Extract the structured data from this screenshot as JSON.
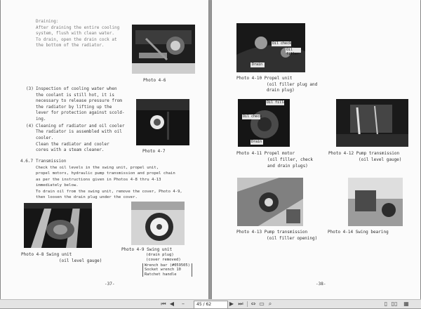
{
  "left_page": {
    "draining_title": "Draining:",
    "draining_lines": [
      "After draining the entire cooling",
      "system, flush with clean water.",
      "To drain, open the drain cock at",
      "the bottom of the radiator."
    ],
    "photo_4_6_caption": "Photo 4-6",
    "item3_num": "(3)",
    "item3_lines": [
      "Inspection of cooling water when",
      "the coolant is still hot, it is",
      "necessary to release pressure from",
      "the radiator by lifting up the",
      "lever for protection against scold-",
      "ing."
    ],
    "item4_num": "(4)",
    "item4_lines": [
      "Cleaning of radiator and oil cooler",
      "The radiator is assembled with oil",
      "cooler.",
      "Clean the radiator and cooler",
      "cores with a steam cleaner."
    ],
    "photo_4_7_caption": "Photo 4-7",
    "section_num": "4.6.7",
    "section_title": "Transmission",
    "section_lines": [
      "Check the oil levels in the swing unit, propel unit,",
      "propel motors, hydraulic pump transmission and propel chain",
      "as per the instructions given in Photos 4-8 thru 4-13",
      "immediately below.",
      "To drain oil from the swing unit, remove the cover, Photo 4-9,",
      "then loosen the drain plug under the cover."
    ],
    "photo_4_8_caption": "Photo 4-8  Swing unit",
    "photo_4_8_sub": "(oil level gauge)",
    "photo_4_9_caption": "Photo 4-9  Swing unit",
    "photo_4_9_sub1": "(drain plug)",
    "photo_4_9_sub2": "(cover removed)",
    "tools": [
      "Wrench bar (#059505)",
      "Socket wrench 10",
      "Ratchet handle"
    ],
    "page_number": "-37-"
  },
  "right_page": {
    "photo_4_10_caption": "Photo 4-10  Propel unit",
    "photo_4_10_sub1": "(oil filler plug and",
    "photo_4_10_sub2": "drain plug)",
    "photo_4_10_labels": [
      "Oil check",
      "Oil filler",
      "Drain"
    ],
    "photo_4_11_caption": "Photo 4-11  Propel motor",
    "photo_4_11_sub1": "(oil filler, check",
    "photo_4_11_sub2": "and drain plugs)",
    "photo_4_11_labels": [
      "Oil filler",
      "Oil check",
      "Drain"
    ],
    "photo_4_12_caption": "Photo 4-12  Pump transmission",
    "photo_4_12_sub": "(oil level gauge)",
    "photo_4_13_caption": "Photo 4-13  Pump transmission",
    "photo_4_13_sub": "(oil filler opening)",
    "photo_4_14_caption": "Photo 4-14  Swing bearing",
    "page_number": "-38-"
  },
  "toolbar": {
    "page_value": "45 / 62",
    "first_icon": "first-page-icon",
    "prev_icon": "prev-page-icon",
    "next_icon": "next-page-icon",
    "last_icon": "last-page-icon"
  }
}
